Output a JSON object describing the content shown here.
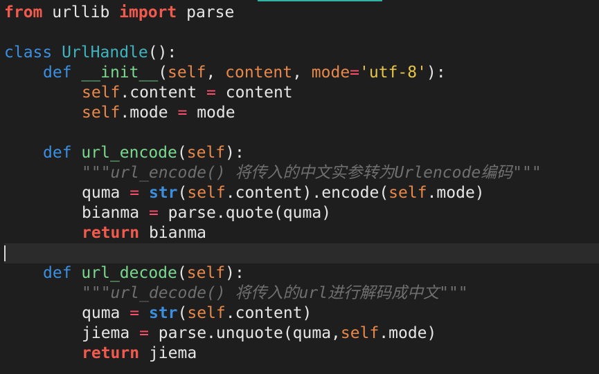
{
  "editor": {
    "accent_color": "#2fb5a5",
    "background": "#1e1e1e"
  },
  "code": {
    "l1": {
      "kw_from": "from",
      "mod": " urllib ",
      "kw_import": "import",
      "name": " parse"
    },
    "l3": {
      "kw_class": "class",
      "sp": " ",
      "class_name": "UrlHandle",
      "tail": "():"
    },
    "l4": {
      "kw_def": "def",
      "sp": " ",
      "fn": "__init__",
      "p1": "(",
      "self": "self",
      "c1": ", ",
      "content": "content",
      "c2": ", ",
      "mode": "mode",
      "eq": "=",
      "str": "'utf-8'",
      "end": "):"
    },
    "l5": {
      "self": "self",
      "rest": ".content ",
      "eq": "=",
      "val": " content"
    },
    "l6": {
      "self": "self",
      "rest": ".mode ",
      "eq": "=",
      "val": " mode"
    },
    "l8": {
      "kw_def": "def",
      "sp": " ",
      "fn": "url_encode",
      "p1": "(",
      "self": "self",
      "end": "):"
    },
    "l9": {
      "doc": "\"\"\"url_encode() 将传入的中文实参转为Urlencode编码\"\"\""
    },
    "l10": {
      "var": "quma ",
      "eq": "=",
      "sp": " ",
      "builtin": "str",
      "p1": "(",
      "self1": "self",
      "mid": ".content).encode(",
      "self2": "self",
      "end": ".mode)"
    },
    "l11": {
      "var": "bianma ",
      "eq": "=",
      "rest": " parse.quote(quma)"
    },
    "l12": {
      "kw_return": "return",
      "val": " bianma"
    },
    "l14": {
      "kw_def": "def",
      "sp": " ",
      "fn": "url_decode",
      "p1": "(",
      "self": "self",
      "end": "):"
    },
    "l15": {
      "doc": "\"\"\"url_decode() 将传入的url进行解码成中文\"\"\""
    },
    "l16": {
      "var": "quma ",
      "eq": "=",
      "sp": " ",
      "builtin": "str",
      "p1": "(",
      "self1": "self",
      "end": ".content)"
    },
    "l17": {
      "var": "jiema ",
      "eq": "=",
      "rest": " parse.unquote(quma,",
      "self": "self",
      "end": ".mode)"
    },
    "l18": {
      "kw_return": "return",
      "val": " jiema"
    }
  }
}
